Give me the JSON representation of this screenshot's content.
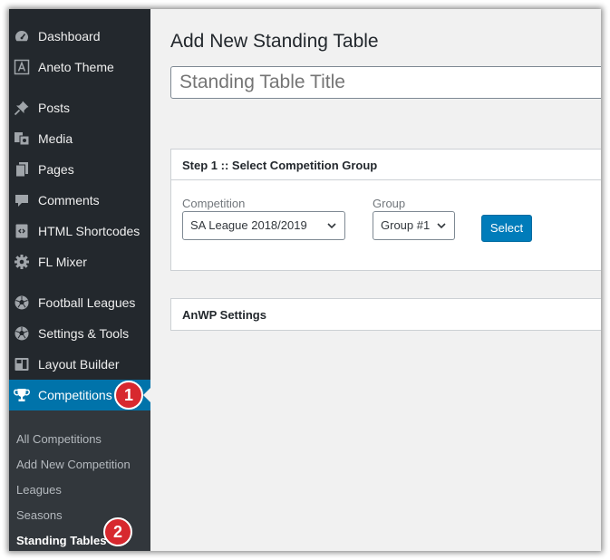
{
  "sidebar": {
    "items": [
      {
        "label": "Dashboard",
        "icon": "dashboard-icon"
      },
      {
        "label": "Aneto Theme",
        "icon": "theme-icon"
      },
      {
        "label": "Posts",
        "icon": "pin-icon"
      },
      {
        "label": "Media",
        "icon": "media-icon"
      },
      {
        "label": "Pages",
        "icon": "pages-icon"
      },
      {
        "label": "Comments",
        "icon": "comment-icon"
      },
      {
        "label": "HTML Shortcodes",
        "icon": "shortcode-icon"
      },
      {
        "label": "FL Mixer",
        "icon": "gear-icon"
      },
      {
        "label": "Football Leagues",
        "icon": "soccer-ball-icon"
      },
      {
        "label": "Settings & Tools",
        "icon": "soccer-ball-icon"
      },
      {
        "label": "Layout Builder",
        "icon": "layout-icon"
      },
      {
        "label": "Competitions",
        "icon": "trophy-icon"
      }
    ],
    "submenu": [
      "All Competitions",
      "Add New Competition",
      "Leagues",
      "Seasons",
      "Standing Tables"
    ],
    "badges": [
      "1",
      "2"
    ]
  },
  "main": {
    "page_title": "Add New Standing Table",
    "title_placeholder": "Standing Table Title",
    "step_panel": {
      "heading": "Step 1 :: Select Competition Group",
      "competition_label": "Competition",
      "competition_value": "SA League 2018/2019",
      "group_label": "Group",
      "group_value": "Group #1",
      "select_button": "Select"
    },
    "settings_panel": {
      "heading": "AnWP Settings"
    }
  },
  "colors": {
    "sidebar_bg": "#23282d",
    "active": "#0073aa",
    "badge": "#d7282e",
    "button": "#007cba"
  }
}
